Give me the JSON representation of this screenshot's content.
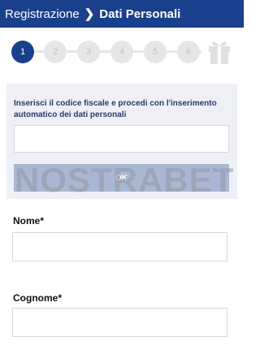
{
  "header": {
    "breadcrumb_parent": "Registrazione",
    "separator": "❯",
    "breadcrumb_current": "Dati Personali"
  },
  "stepper": {
    "steps": [
      "1",
      "2",
      "3",
      "4",
      "5",
      "6"
    ],
    "active_step": 1,
    "final_icon": "gift-icon"
  },
  "fiscal_code": {
    "instruction": "Inserisci il codice fiscale e procedi con l'inserimento automatico dei dati personali",
    "input_value": "",
    "button_label": "OK"
  },
  "watermark": {
    "text": "NOSTRABET"
  },
  "form": {
    "nome_label": "Nome*",
    "nome_value": "",
    "cognome_label": "Cognome*",
    "cognome_value": ""
  },
  "colors": {
    "header_bg": "#1a3f8c",
    "active_step": "#1a3f8c",
    "panel_bg": "#eef0f6",
    "button_bg": "#a8b8d4"
  }
}
